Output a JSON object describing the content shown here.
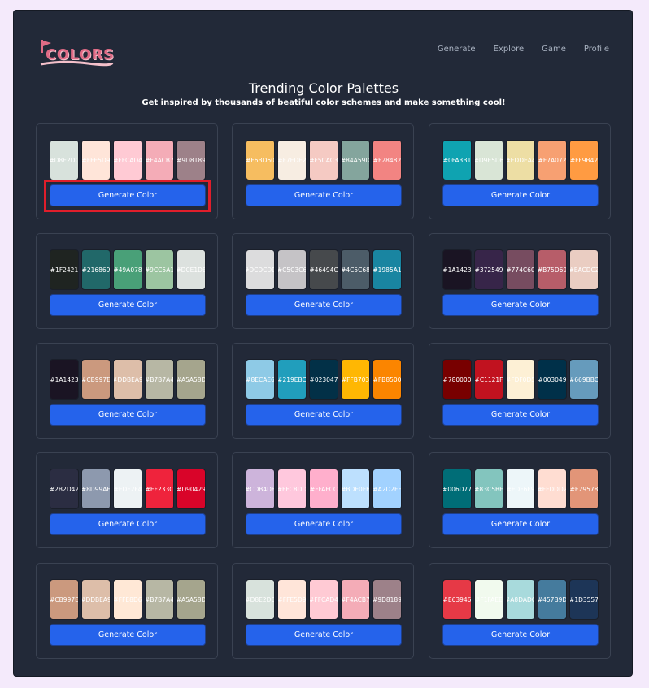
{
  "nav": [
    "Generate",
    "Explore",
    "Game",
    "Profile"
  ],
  "logo_text": "COLORS",
  "title": "Trending Color Palettes",
  "subtitle": "Get inspired by thousands of beatiful color schemes and make something cool!",
  "button_label": "Generate Color",
  "palettes": [
    [
      "#D8E2DC",
      "#FFE5D9",
      "#FFCAD4",
      "#F4ACB7",
      "#9D8189"
    ],
    [
      "#F6BD60",
      "#F7EDE2",
      "#F5CAC3",
      "#84A59D",
      "#F28482"
    ],
    [
      "#0FA3B1",
      "#D9E5D6",
      "#EDDEA4",
      "#F7A072",
      "#FF9B42"
    ],
    [
      "#1F2421",
      "#216869",
      "#49A078",
      "#9CC5A1",
      "#DCE1DE"
    ],
    [
      "#DCDCDD",
      "#C5C3C6",
      "#46494C",
      "#4C5C68",
      "#1985A1"
    ],
    [
      "#1A1423",
      "#372549",
      "#774C60",
      "#B75D69",
      "#EACDC2"
    ],
    [
      "#1A1423",
      "#CB997E",
      "#DDBEA9",
      "#B7B7A4",
      "#A5A58D"
    ],
    [
      "#8ECAE6",
      "#219EBC",
      "#023047",
      "#FFB703",
      "#FB8500"
    ],
    [
      "#780000",
      "#C1121F",
      "#FDF0D5",
      "#003049",
      "#669BBC"
    ],
    [
      "#2B2D42",
      "#8D99AE",
      "#EDF2F4",
      "#EF233C",
      "#D90429"
    ],
    [
      "#CDB4DB",
      "#FFC8DD",
      "#FFAFCC",
      "#BDE0FE",
      "#A2D2FF"
    ],
    [
      "#006D77",
      "#83C5BE",
      "#EDF6F9",
      "#FFDDD2",
      "#E29578"
    ],
    [
      "#CB997E",
      "#DDBEA9",
      "#FFE8D6",
      "#B7B7A4",
      "#A5A58D"
    ],
    [
      "#D8E2DC",
      "#FFE5D9",
      "#FFCAD4",
      "#F4ACB7",
      "#9D8189"
    ],
    [
      "#E63946",
      "#F1FAEE",
      "#A8DADC",
      "#457B9D",
      "#1D3557"
    ]
  ],
  "colors": {
    "background": "#222938",
    "button": "#2563eb",
    "highlight": "#e01e2b",
    "page": "#f4eafb"
  }
}
